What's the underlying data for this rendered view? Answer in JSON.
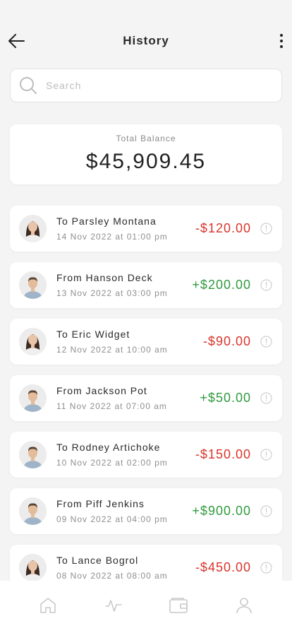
{
  "header": {
    "title": "History",
    "back_icon": "arrow-left-icon",
    "menu_icon": "more-vertical-icon"
  },
  "search": {
    "placeholder": "Search",
    "value": "",
    "icon": "search-icon"
  },
  "balance": {
    "label": "Total Balance",
    "value": "$45,909.45"
  },
  "colors": {
    "negative": "#d9342b",
    "positive": "#2f9a3e",
    "background": "#f4f4f4",
    "card": "#ffffff"
  },
  "transactions": [
    {
      "name": "To Parsley Montana",
      "date": "14 Nov 2022 at 01:00 pm",
      "amount": "-$120.00",
      "direction": "out",
      "avatar": "avatar-woman-icon"
    },
    {
      "name": "From Hanson Deck",
      "date": "13 Nov 2022 at 03:00 pm",
      "amount": "+$200.00",
      "direction": "in",
      "avatar": "avatar-man-icon"
    },
    {
      "name": "To Eric Widget",
      "date": "12 Nov 2022 at 10:00 am",
      "amount": "-$90.00",
      "direction": "out",
      "avatar": "avatar-woman-icon"
    },
    {
      "name": "From Jackson Pot",
      "date": "11 Nov 2022 at 07:00 am",
      "amount": "+$50.00",
      "direction": "in",
      "avatar": "avatar-man-icon"
    },
    {
      "name": "To Rodney Artichoke",
      "date": "10 Nov 2022 at 02:00 pm",
      "amount": "-$150.00",
      "direction": "out",
      "avatar": "avatar-man-icon"
    },
    {
      "name": "From Piff Jenkins",
      "date": "09 Nov 2022 at 04:00 pm",
      "amount": "+$900.00",
      "direction": "in",
      "avatar": "avatar-man-icon"
    },
    {
      "name": "To Lance Bogrol",
      "date": "08 Nov 2022 at 08:00 am",
      "amount": "-$450.00",
      "direction": "out",
      "avatar": "avatar-woman-icon"
    }
  ],
  "bottom_nav": [
    {
      "icon": "home-icon"
    },
    {
      "icon": "activity-icon"
    },
    {
      "icon": "wallet-icon"
    },
    {
      "icon": "profile-icon"
    }
  ]
}
